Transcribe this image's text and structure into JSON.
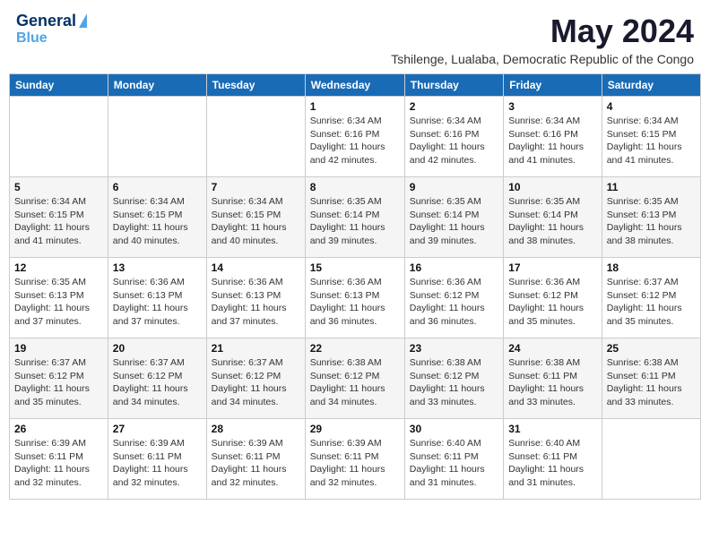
{
  "header": {
    "logo_line1": "General",
    "logo_line2": "Blue",
    "month_year": "May 2024",
    "location": "Tshilenge, Lualaba, Democratic Republic of the Congo"
  },
  "days_of_week": [
    "Sunday",
    "Monday",
    "Tuesday",
    "Wednesday",
    "Thursday",
    "Friday",
    "Saturday"
  ],
  "weeks": [
    [
      {
        "day": "",
        "info": ""
      },
      {
        "day": "",
        "info": ""
      },
      {
        "day": "",
        "info": ""
      },
      {
        "day": "1",
        "info": "Sunrise: 6:34 AM\nSunset: 6:16 PM\nDaylight: 11 hours\nand 42 minutes."
      },
      {
        "day": "2",
        "info": "Sunrise: 6:34 AM\nSunset: 6:16 PM\nDaylight: 11 hours\nand 42 minutes."
      },
      {
        "day": "3",
        "info": "Sunrise: 6:34 AM\nSunset: 6:16 PM\nDaylight: 11 hours\nand 41 minutes."
      },
      {
        "day": "4",
        "info": "Sunrise: 6:34 AM\nSunset: 6:15 PM\nDaylight: 11 hours\nand 41 minutes."
      }
    ],
    [
      {
        "day": "5",
        "info": "Sunrise: 6:34 AM\nSunset: 6:15 PM\nDaylight: 11 hours\nand 41 minutes."
      },
      {
        "day": "6",
        "info": "Sunrise: 6:34 AM\nSunset: 6:15 PM\nDaylight: 11 hours\nand 40 minutes."
      },
      {
        "day": "7",
        "info": "Sunrise: 6:34 AM\nSunset: 6:15 PM\nDaylight: 11 hours\nand 40 minutes."
      },
      {
        "day": "8",
        "info": "Sunrise: 6:35 AM\nSunset: 6:14 PM\nDaylight: 11 hours\nand 39 minutes."
      },
      {
        "day": "9",
        "info": "Sunrise: 6:35 AM\nSunset: 6:14 PM\nDaylight: 11 hours\nand 39 minutes."
      },
      {
        "day": "10",
        "info": "Sunrise: 6:35 AM\nSunset: 6:14 PM\nDaylight: 11 hours\nand 38 minutes."
      },
      {
        "day": "11",
        "info": "Sunrise: 6:35 AM\nSunset: 6:13 PM\nDaylight: 11 hours\nand 38 minutes."
      }
    ],
    [
      {
        "day": "12",
        "info": "Sunrise: 6:35 AM\nSunset: 6:13 PM\nDaylight: 11 hours\nand 37 minutes."
      },
      {
        "day": "13",
        "info": "Sunrise: 6:36 AM\nSunset: 6:13 PM\nDaylight: 11 hours\nand 37 minutes."
      },
      {
        "day": "14",
        "info": "Sunrise: 6:36 AM\nSunset: 6:13 PM\nDaylight: 11 hours\nand 37 minutes."
      },
      {
        "day": "15",
        "info": "Sunrise: 6:36 AM\nSunset: 6:13 PM\nDaylight: 11 hours\nand 36 minutes."
      },
      {
        "day": "16",
        "info": "Sunrise: 6:36 AM\nSunset: 6:12 PM\nDaylight: 11 hours\nand 36 minutes."
      },
      {
        "day": "17",
        "info": "Sunrise: 6:36 AM\nSunset: 6:12 PM\nDaylight: 11 hours\nand 35 minutes."
      },
      {
        "day": "18",
        "info": "Sunrise: 6:37 AM\nSunset: 6:12 PM\nDaylight: 11 hours\nand 35 minutes."
      }
    ],
    [
      {
        "day": "19",
        "info": "Sunrise: 6:37 AM\nSunset: 6:12 PM\nDaylight: 11 hours\nand 35 minutes."
      },
      {
        "day": "20",
        "info": "Sunrise: 6:37 AM\nSunset: 6:12 PM\nDaylight: 11 hours\nand 34 minutes."
      },
      {
        "day": "21",
        "info": "Sunrise: 6:37 AM\nSunset: 6:12 PM\nDaylight: 11 hours\nand 34 minutes."
      },
      {
        "day": "22",
        "info": "Sunrise: 6:38 AM\nSunset: 6:12 PM\nDaylight: 11 hours\nand 34 minutes."
      },
      {
        "day": "23",
        "info": "Sunrise: 6:38 AM\nSunset: 6:12 PM\nDaylight: 11 hours\nand 33 minutes."
      },
      {
        "day": "24",
        "info": "Sunrise: 6:38 AM\nSunset: 6:11 PM\nDaylight: 11 hours\nand 33 minutes."
      },
      {
        "day": "25",
        "info": "Sunrise: 6:38 AM\nSunset: 6:11 PM\nDaylight: 11 hours\nand 33 minutes."
      }
    ],
    [
      {
        "day": "26",
        "info": "Sunrise: 6:39 AM\nSunset: 6:11 PM\nDaylight: 11 hours\nand 32 minutes."
      },
      {
        "day": "27",
        "info": "Sunrise: 6:39 AM\nSunset: 6:11 PM\nDaylight: 11 hours\nand 32 minutes."
      },
      {
        "day": "28",
        "info": "Sunrise: 6:39 AM\nSunset: 6:11 PM\nDaylight: 11 hours\nand 32 minutes."
      },
      {
        "day": "29",
        "info": "Sunrise: 6:39 AM\nSunset: 6:11 PM\nDaylight: 11 hours\nand 32 minutes."
      },
      {
        "day": "30",
        "info": "Sunrise: 6:40 AM\nSunset: 6:11 PM\nDaylight: 11 hours\nand 31 minutes."
      },
      {
        "day": "31",
        "info": "Sunrise: 6:40 AM\nSunset: 6:11 PM\nDaylight: 11 hours\nand 31 minutes."
      },
      {
        "day": "",
        "info": ""
      }
    ]
  ]
}
